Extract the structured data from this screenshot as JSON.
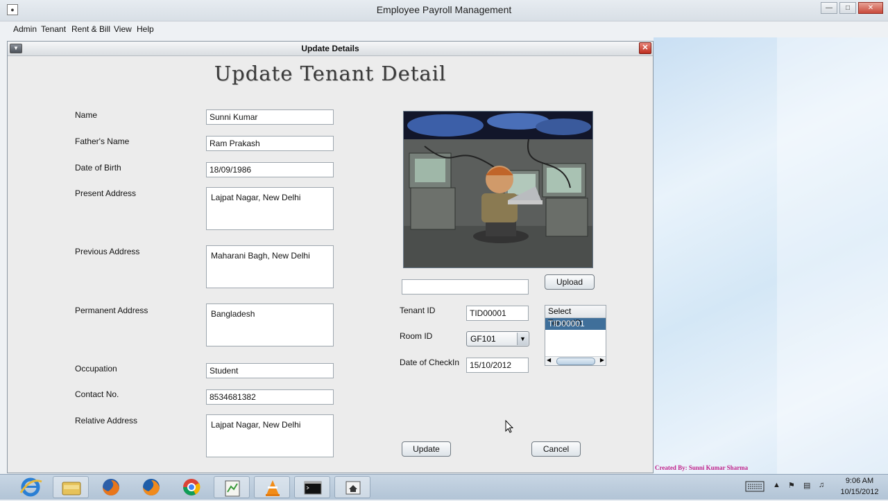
{
  "window": {
    "title": "Employee Payroll Management"
  },
  "menu": [
    "Admin",
    "Tenant",
    "Rent & Bill",
    "View",
    "Help"
  ],
  "dialog": {
    "title": "Update Details",
    "heading": "Update Tenant Detail",
    "labels": {
      "name": "Name",
      "father": "Father's Name",
      "dob": "Date of Birth",
      "present": "Present Address",
      "previous": "Previous Address",
      "permanent": "Permanent Address",
      "occupation": "Occupation",
      "contact": "Contact No.",
      "relative": "Relative Address",
      "tenant_id": "Tenant ID",
      "room_id": "Room ID",
      "checkin": "Date of CheckIn"
    },
    "values": {
      "name": "Sunni Kumar",
      "father": "Ram Prakash",
      "dob": "18/09/1986",
      "present": "Lajpat Nagar, New Delhi",
      "previous": "Maharani Bagh, New Delhi",
      "permanent": "Bangladesh",
      "occupation": "Student",
      "contact": "8534681382",
      "relative": "Lajpat Nagar, New Delhi",
      "photo_path": "",
      "tenant_id": "TID00001",
      "room_id": "GF101",
      "checkin": "15/10/2012"
    },
    "buttons": {
      "upload": "Upload",
      "update": "Update",
      "cancel": "Cancel"
    },
    "tenant_list": {
      "header": "Select TenantID",
      "items": [
        "TID00001"
      ],
      "selected": "TID00001"
    }
  },
  "footer_credit": "Created By: Sunni Kumar Sharma",
  "clock": {
    "time": "9:06 AM",
    "date": "10/15/2012"
  },
  "colors": {
    "selection": "#3f6f9a",
    "credit": "#c0208a"
  }
}
